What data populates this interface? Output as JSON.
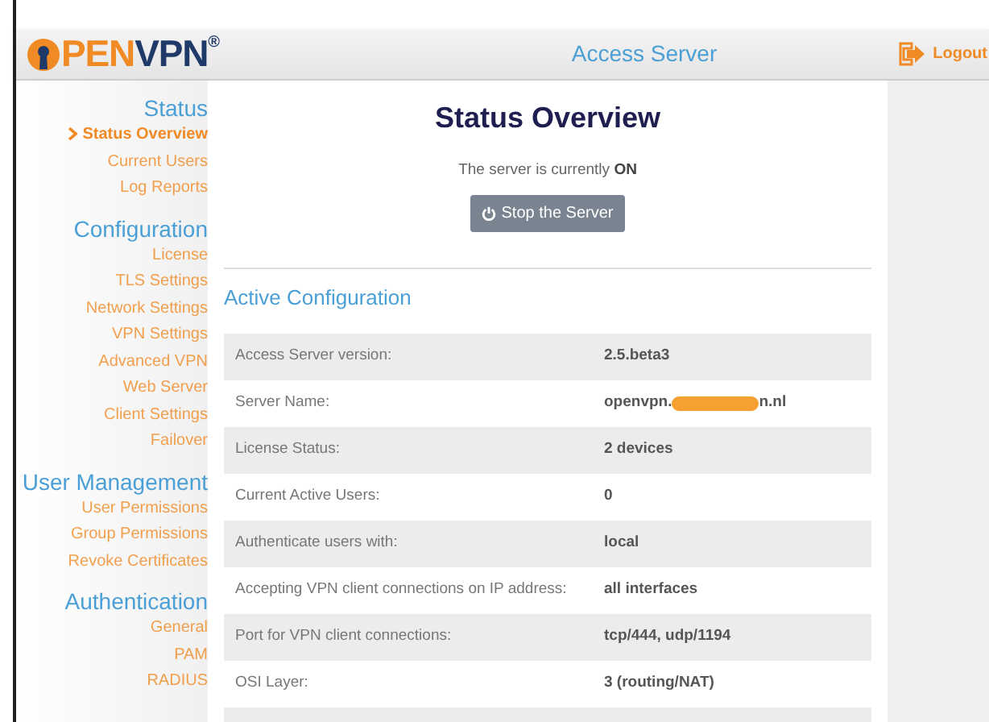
{
  "header": {
    "logo": {
      "parts": [
        {
          "text": "PEN",
          "color": "#f08a24"
        },
        {
          "text": "VPN",
          "color": "#1f3a68"
        }
      ],
      "mark": "®"
    },
    "title": "Access Server",
    "logout": "Logout"
  },
  "sidebar": [
    {
      "heading": "Status",
      "items": [
        {
          "label": "Status Overview",
          "selected": true
        },
        {
          "label": "Current Users",
          "selected": false
        },
        {
          "label": "Log Reports",
          "selected": false
        }
      ]
    },
    {
      "heading": "Configuration",
      "items": [
        {
          "label": "License",
          "selected": false
        },
        {
          "label": "TLS Settings",
          "selected": false
        },
        {
          "label": "Network Settings",
          "selected": false
        },
        {
          "label": "VPN Settings",
          "selected": false
        },
        {
          "label": "Advanced VPN",
          "selected": false
        },
        {
          "label": "Web Server",
          "selected": false
        },
        {
          "label": "Client Settings",
          "selected": false
        },
        {
          "label": "Failover",
          "selected": false
        }
      ]
    },
    {
      "heading": "User Management",
      "items": [
        {
          "label": "User Permissions",
          "selected": false
        },
        {
          "label": "Group Permissions",
          "selected": false
        },
        {
          "label": "Revoke Certificates",
          "selected": false
        }
      ]
    },
    {
      "heading": "Authentication",
      "items": [
        {
          "label": "General",
          "selected": false
        },
        {
          "label": "PAM",
          "selected": false
        },
        {
          "label": "RADIUS",
          "selected": false
        }
      ]
    }
  ],
  "main": {
    "title": "Status Overview",
    "status_text": "The server is currently ",
    "status_value": "ON",
    "button": "Stop the Server",
    "section": "Active Configuration",
    "rows": [
      {
        "label": "Access Server version:",
        "value": "2.5.beta3"
      },
      {
        "label": "Server Name:",
        "value": "openvpn.",
        "redacted": true,
        "value_end": "n.nl"
      },
      {
        "label": "License Status:",
        "value": "2 devices"
      },
      {
        "label": "Current Active Users:",
        "value": "0"
      },
      {
        "label": "Authenticate users with:",
        "value": "local"
      },
      {
        "label": "Accepting VPN client connections on IP address:",
        "value": "all interfaces"
      },
      {
        "label": "Port for VPN client connections:",
        "value": "tcp/444, udp/1194"
      },
      {
        "label": "OSI Layer:",
        "value": "3 (routing/NAT)"
      }
    ]
  }
}
